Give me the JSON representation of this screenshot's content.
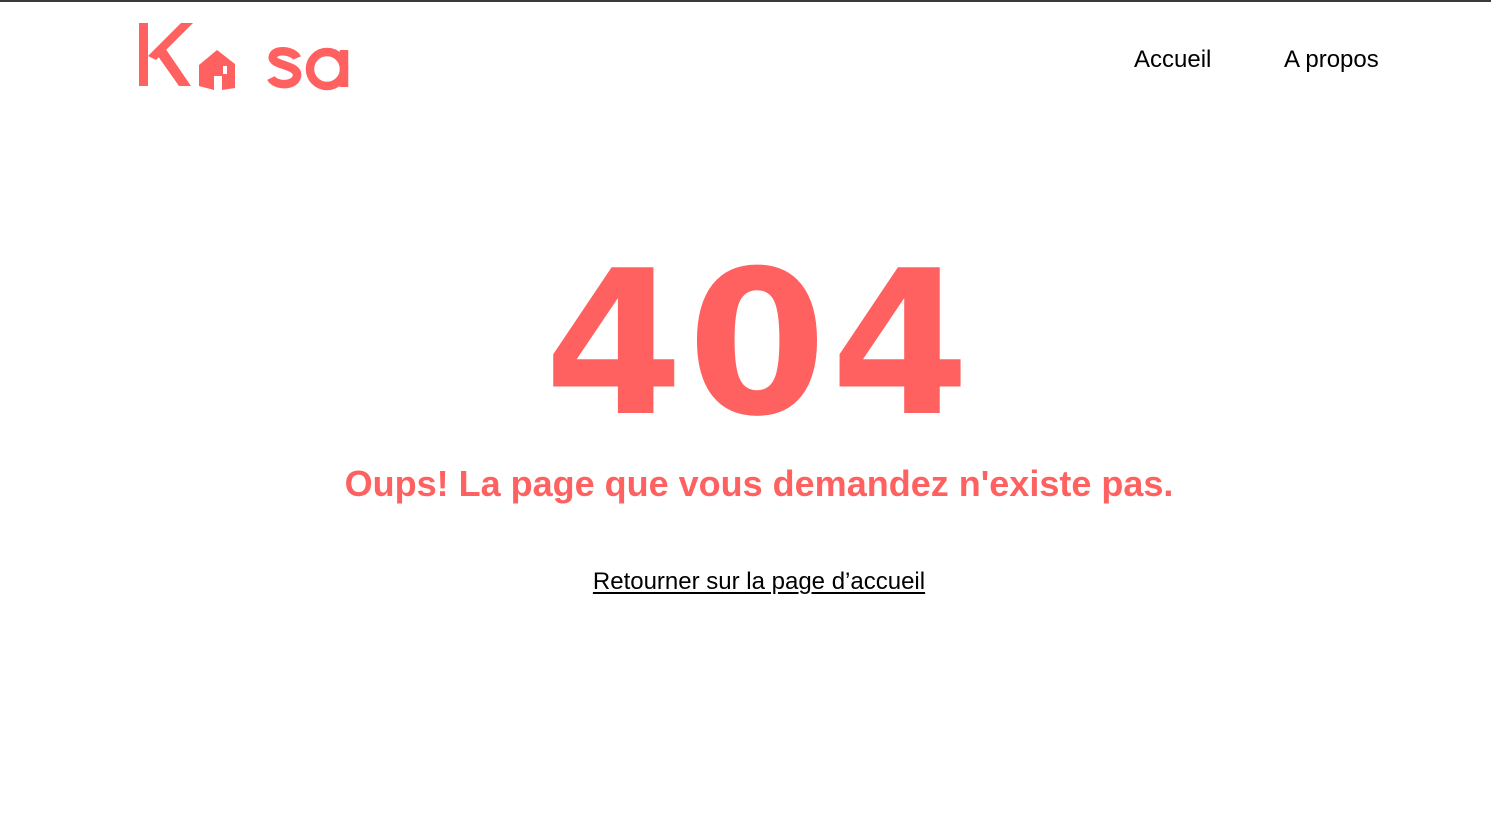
{
  "brand": {
    "logo_text": "Kasa",
    "color": "#ff6060"
  },
  "nav": {
    "items": [
      {
        "label": "Accueil"
      },
      {
        "label": "A propos"
      }
    ]
  },
  "error": {
    "code": "404",
    "message": "Oups! La page que vous demandez n'existe pas.",
    "home_link_label": "Retourner sur la page d’accueil"
  },
  "colors": {
    "accent": "#ff6060",
    "text": "#000000",
    "background": "#ffffff"
  }
}
